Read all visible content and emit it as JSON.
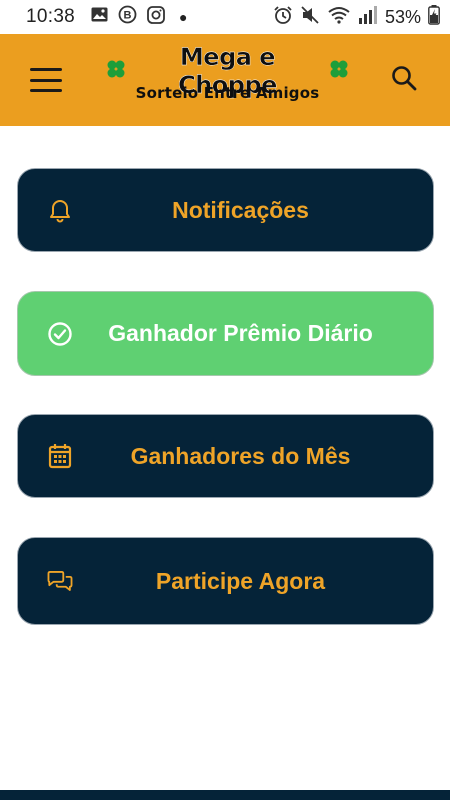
{
  "status_bar": {
    "time": "10:38",
    "battery": "53%",
    "icons_left": [
      "image-icon",
      "b-badge-icon",
      "instagram-icon",
      "dot-icon"
    ],
    "icons_right": [
      "alarm-icon",
      "mute-icon",
      "wifi-icon",
      "signal-icon",
      "battery-icon"
    ]
  },
  "header": {
    "brand_title": "Mega e Choppe",
    "brand_subtitle": "Sorteio Entre Amigos",
    "left_icon": "menu-icon",
    "right_icon": "search-icon",
    "background_color": "#EB9E1F"
  },
  "menu": {
    "items": [
      {
        "label": "Notificações",
        "icon": "bell-icon",
        "color": "#052338"
      },
      {
        "label": "Ganhador Prêmio Diário",
        "icon": "check-circle-icon",
        "color": "#5FD072"
      },
      {
        "label": "Ganhadores do Mês",
        "icon": "calendar-icon",
        "color": "#052338"
      },
      {
        "label": "Participe Agora",
        "icon": "chat-bubbles-icon",
        "color": "#052338"
      }
    ],
    "accent_color": "#EFA428"
  }
}
